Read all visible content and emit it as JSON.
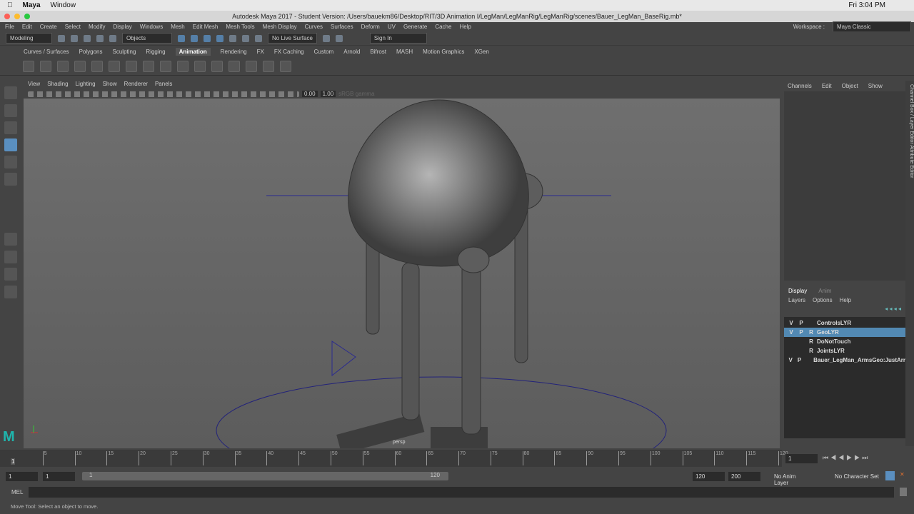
{
  "mac": {
    "app": "Maya",
    "menu": "Window",
    "clock": "Fri 3:04 PM"
  },
  "title": "Autodesk Maya 2017 - Student Version: /Users/bauekm86/Desktop/RIT/3D Animation I/LegMan/LegManRig/LegManRig/scenes/Bauer_LegMan_BaseRig.mb*",
  "menus": [
    "File",
    "Edit",
    "Create",
    "Select",
    "Modify",
    "Display",
    "Windows",
    "Mesh",
    "Edit Mesh",
    "Mesh Tools",
    "Mesh Display",
    "Curves",
    "Surfaces",
    "Deform",
    "UV",
    "Generate",
    "Cache",
    "Help"
  ],
  "workspace": {
    "label": "Workspace :",
    "value": "Maya Classic"
  },
  "status": {
    "mode": "Modeling",
    "objects": "Objects",
    "live_surface": "No Live Surface",
    "sign_in": "Sign In"
  },
  "shelf_tabs": [
    "Curves / Surfaces",
    "Polygons",
    "Sculpting",
    "Rigging",
    "Animation",
    "Rendering",
    "FX",
    "FX Caching",
    "Custom",
    "Arnold",
    "Bifrost",
    "MASH",
    "Motion Graphics",
    "XGen"
  ],
  "shelf_active": "Animation",
  "viewport": {
    "menus": [
      "View",
      "Shading",
      "Lighting",
      "Show",
      "Renderer",
      "Panels"
    ],
    "exposure": "0.00",
    "gamma": "1.00",
    "colorspace": "sRGB gamma",
    "camera": "persp"
  },
  "channel_box": {
    "menus": [
      "Channels",
      "Edit",
      "Object",
      "Show"
    ]
  },
  "side_tabs": "Channel Box / Layer Editor   Attribute Editor",
  "layer_editor": {
    "tabs": [
      "Display",
      "Anim"
    ],
    "menus": [
      "Layers",
      "Options",
      "Help"
    ],
    "layers": [
      {
        "v": "V",
        "p": "P",
        "r": "",
        "name": "ControlsLYR"
      },
      {
        "v": "V",
        "p": "P",
        "r": "R",
        "name": "GeoLYR"
      },
      {
        "v": "",
        "p": "",
        "r": "R",
        "name": "DoNotTouch"
      },
      {
        "v": "",
        "p": "",
        "r": "R",
        "name": "JointsLYR"
      },
      {
        "v": "V",
        "p": "P",
        "r": "",
        "name": "Bauer_LegMan_ArmsGeo:JustArr"
      }
    ]
  },
  "timeline": {
    "ticks": [
      "5",
      "10",
      "15",
      "20",
      "25",
      "30",
      "35",
      "40",
      "45",
      "50",
      "55",
      "60",
      "65",
      "70",
      "75",
      "80",
      "85",
      "90",
      "95",
      "100",
      "105",
      "110",
      "115",
      "120"
    ],
    "current": "1",
    "current_field": "1"
  },
  "range": {
    "start": "1",
    "play_start": "1",
    "slider_start": "1",
    "slider_end": "120",
    "play_end": "120",
    "end": "200",
    "anim_layer": "No Anim Layer",
    "char_set": "No Character Set"
  },
  "cmd": {
    "label": "MEL"
  },
  "help_line": "Move Tool: Select an object to move."
}
